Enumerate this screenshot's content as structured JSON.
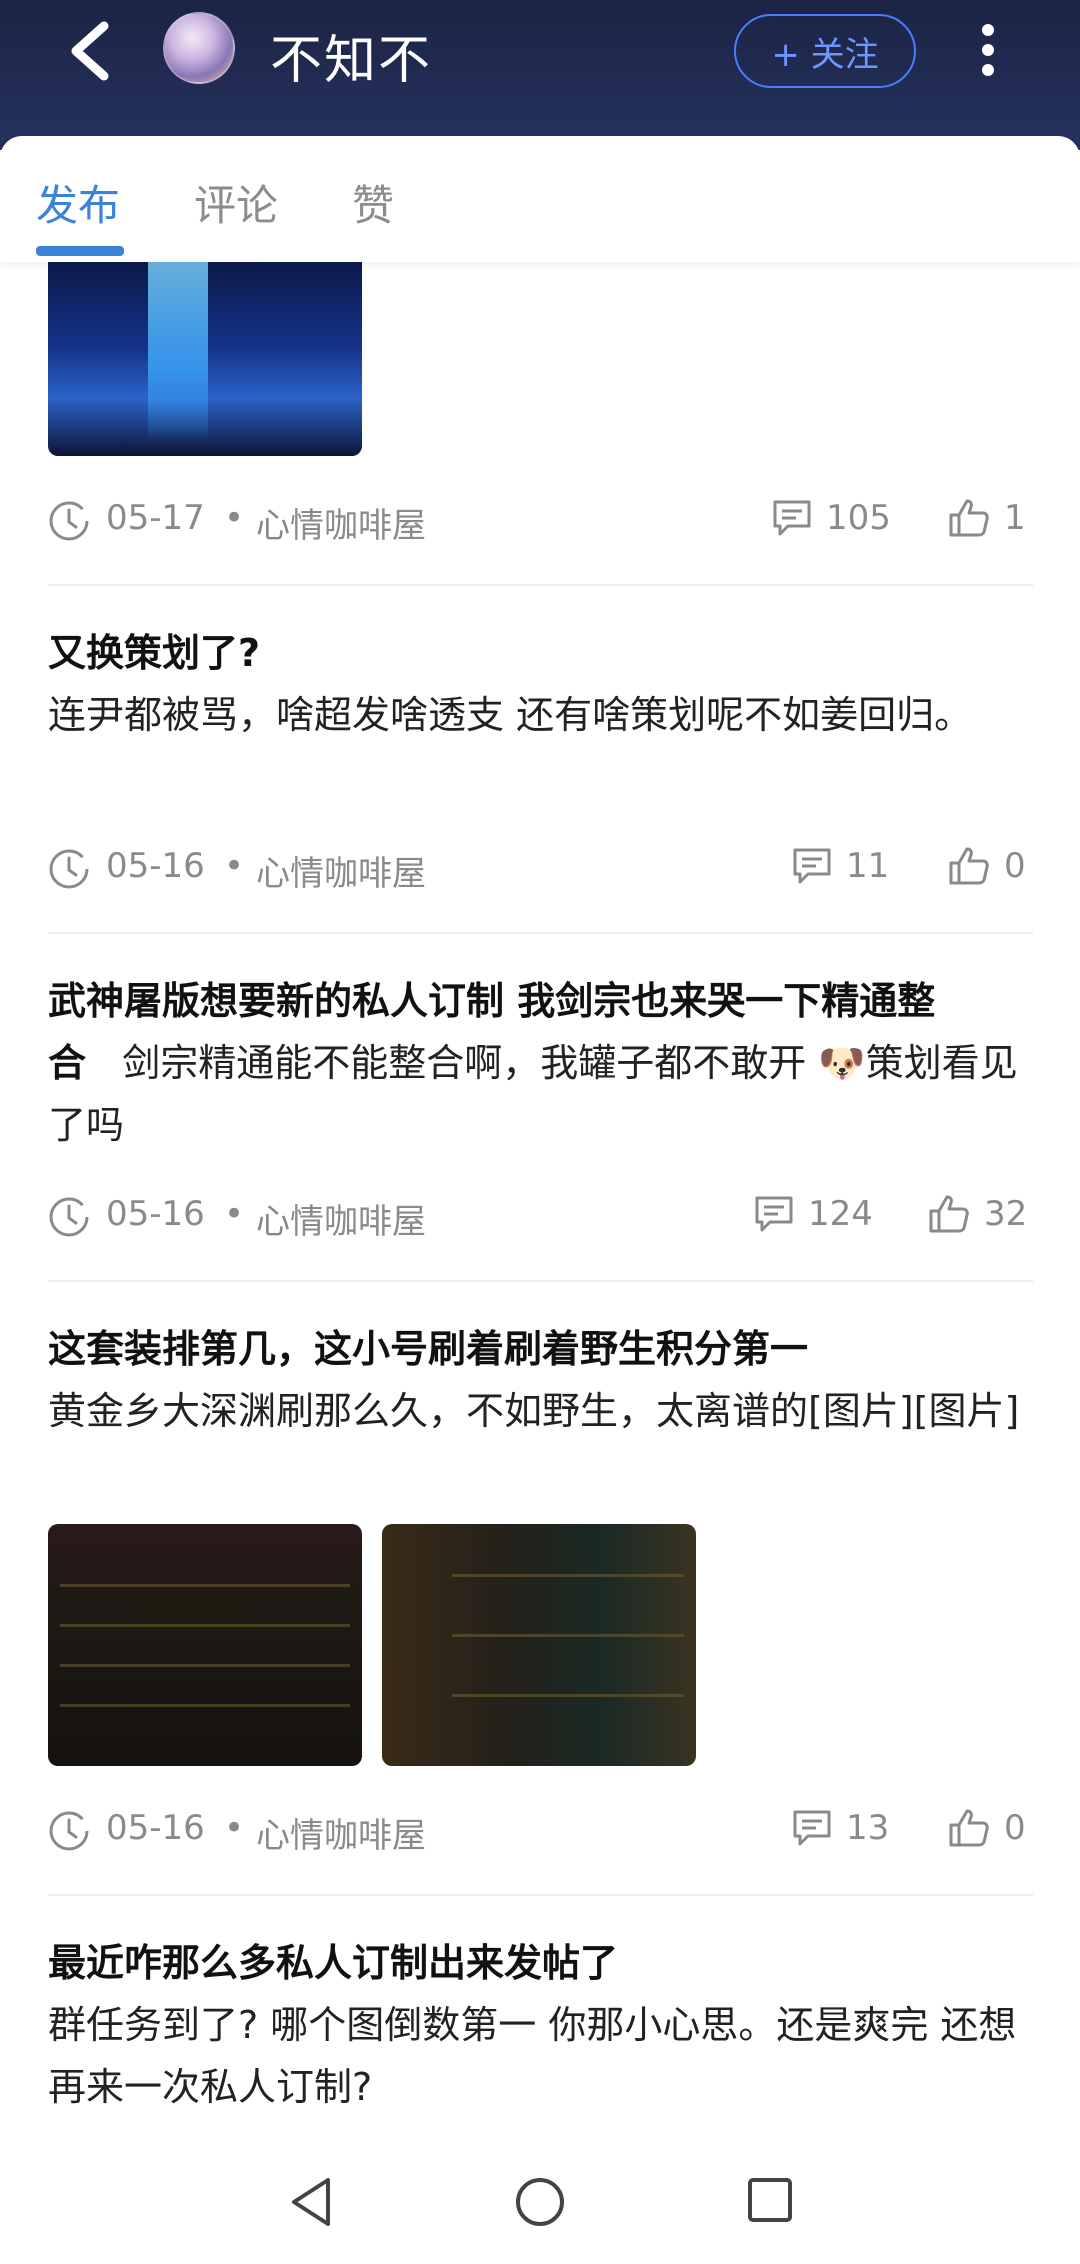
{
  "header": {
    "user_name": "不知不",
    "follow_label": "+ 关注"
  },
  "tabs": [
    {
      "label": "发布",
      "active": true
    },
    {
      "label": "评论",
      "active": false
    },
    {
      "label": "赞",
      "active": false
    }
  ],
  "posts": [
    {
      "title": "",
      "body": "",
      "images": [
        "game-screenshot-blue"
      ],
      "date": "05-17",
      "source": "心情咖啡屋",
      "comments": "105",
      "likes": "1"
    },
    {
      "title": "又换策划了?",
      "body": "连尹都被骂，啥超发啥透支 还有啥策划呢不如姜回归。",
      "images": [],
      "date": "05-16",
      "source": "心情咖啡屋",
      "comments": "11",
      "likes": "0"
    },
    {
      "title": "武神屠版想要新的私人订制 我剑宗也来哭一下精通整合",
      "body": "剑宗精通能不能整合啊，我罐子都不敢开 🐶策划看见了吗",
      "images": [],
      "date": "05-16",
      "source": "心情咖啡屋",
      "comments": "124",
      "likes": "32"
    },
    {
      "title": "这套装排第几，这小号刷着刷着野生积分第一",
      "body": "黄金乡大深渊刷那么久，不如野生，太离谱的[图片][图片]",
      "images": [
        "game-screenshot-equipment",
        "game-screenshot-set"
      ],
      "date": "05-16",
      "source": "心情咖啡屋",
      "comments": "13",
      "likes": "0"
    },
    {
      "title": "最近咋那么多私人订制出来发帖了",
      "body": "群任务到了? 哪个图倒数第一 你那小心思。还是爽完 还想再来一次私人订制?",
      "images": [],
      "date": "",
      "source": "",
      "comments": "",
      "likes": ""
    }
  ],
  "separator": "•",
  "colors": {
    "accent": "#3b82d9",
    "follow": "#4a7dff",
    "header_bg": "#1c2444"
  }
}
